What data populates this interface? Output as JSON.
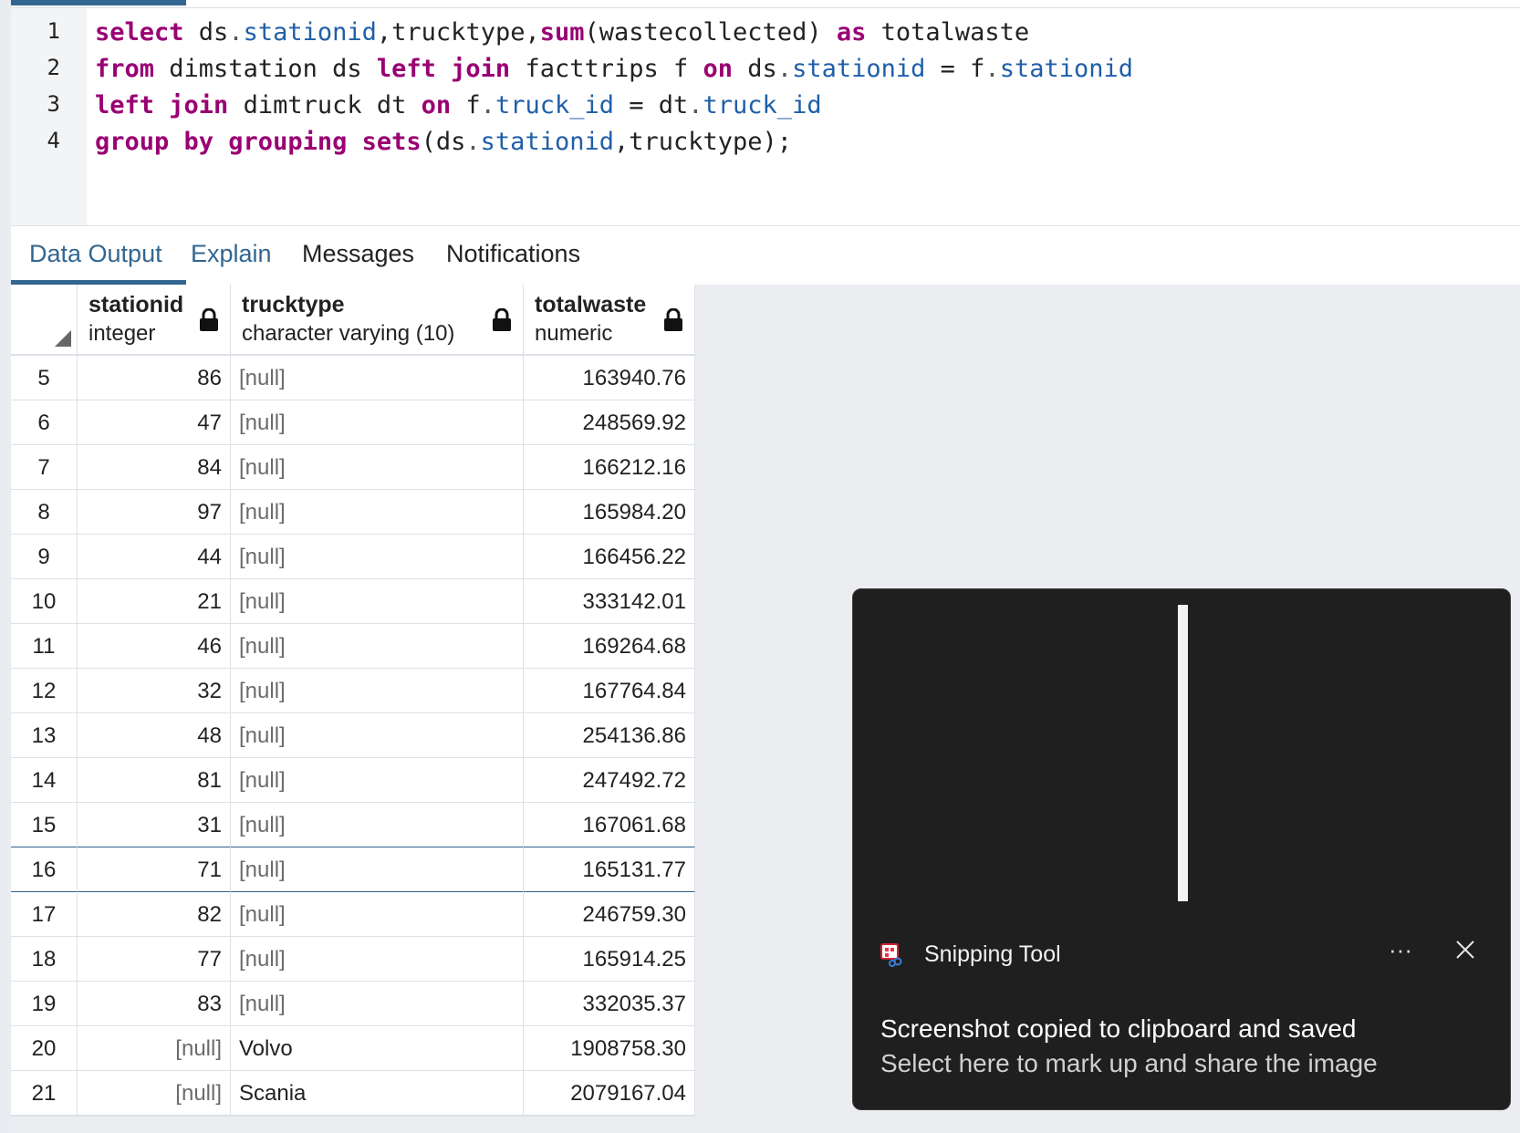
{
  "editor": {
    "line_numbers": [
      "1",
      "2",
      "3",
      "4"
    ],
    "lines": [
      [
        {
          "t": "select",
          "c": "kw"
        },
        {
          "t": " ds",
          "c": ""
        },
        {
          "t": ".",
          "c": "punc"
        },
        {
          "t": "stationid",
          "c": "col"
        },
        {
          "t": ",trucktype,",
          "c": ""
        },
        {
          "t": "sum",
          "c": "fn"
        },
        {
          "t": "(wastecollected)",
          "c": ""
        },
        {
          "t": " as",
          "c": "kw"
        },
        {
          "t": " totalwaste",
          "c": ""
        }
      ],
      [
        {
          "t": "from",
          "c": "kw"
        },
        {
          "t": " dimstation ds ",
          "c": ""
        },
        {
          "t": "left join",
          "c": "kw"
        },
        {
          "t": " facttrips f ",
          "c": ""
        },
        {
          "t": "on",
          "c": "kw"
        },
        {
          "t": " ds",
          "c": ""
        },
        {
          "t": ".",
          "c": "punc"
        },
        {
          "t": "stationid",
          "c": "col"
        },
        {
          "t": " = f",
          "c": ""
        },
        {
          "t": ".",
          "c": "punc"
        },
        {
          "t": "stationid",
          "c": "col"
        }
      ],
      [
        {
          "t": "left join",
          "c": "kw"
        },
        {
          "t": " dimtruck dt ",
          "c": ""
        },
        {
          "t": "on",
          "c": "kw"
        },
        {
          "t": " f",
          "c": ""
        },
        {
          "t": ".",
          "c": "punc"
        },
        {
          "t": "truck_id",
          "c": "col"
        },
        {
          "t": " = dt",
          "c": ""
        },
        {
          "t": ".",
          "c": "punc"
        },
        {
          "t": "truck_id",
          "c": "col"
        }
      ],
      [
        {
          "t": "group by grouping sets",
          "c": "kw"
        },
        {
          "t": "(ds",
          "c": ""
        },
        {
          "t": ".",
          "c": "punc"
        },
        {
          "t": "stationid",
          "c": "col"
        },
        {
          "t": ",trucktype);",
          "c": ""
        }
      ]
    ]
  },
  "tabs": [
    {
      "label": "Data Output",
      "active": true
    },
    {
      "label": "Explain",
      "active": false
    },
    {
      "label": "Messages",
      "active": false
    },
    {
      "label": "Notifications",
      "active": false
    }
  ],
  "grid": {
    "columns": [
      {
        "name": "stationid",
        "type": "integer"
      },
      {
        "name": "trucktype",
        "type": "character varying (10)"
      },
      {
        "name": "totalwaste",
        "type": "numeric"
      }
    ],
    "rows": [
      {
        "n": "5",
        "stationid": "86",
        "trucktype": "[null]",
        "totalwaste": "163940.76"
      },
      {
        "n": "6",
        "stationid": "47",
        "trucktype": "[null]",
        "totalwaste": "248569.92"
      },
      {
        "n": "7",
        "stationid": "84",
        "trucktype": "[null]",
        "totalwaste": "166212.16"
      },
      {
        "n": "8",
        "stationid": "97",
        "trucktype": "[null]",
        "totalwaste": "165984.20"
      },
      {
        "n": "9",
        "stationid": "44",
        "trucktype": "[null]",
        "totalwaste": "166456.22"
      },
      {
        "n": "10",
        "stationid": "21",
        "trucktype": "[null]",
        "totalwaste": "333142.01"
      },
      {
        "n": "11",
        "stationid": "46",
        "trucktype": "[null]",
        "totalwaste": "169264.68"
      },
      {
        "n": "12",
        "stationid": "32",
        "trucktype": "[null]",
        "totalwaste": "167764.84"
      },
      {
        "n": "13",
        "stationid": "48",
        "trucktype": "[null]",
        "totalwaste": "254136.86"
      },
      {
        "n": "14",
        "stationid": "81",
        "trucktype": "[null]",
        "totalwaste": "247492.72"
      },
      {
        "n": "15",
        "stationid": "31",
        "trucktype": "[null]",
        "totalwaste": "167061.68"
      },
      {
        "n": "16",
        "stationid": "71",
        "trucktype": "[null]",
        "totalwaste": "165131.77",
        "selected": true
      },
      {
        "n": "17",
        "stationid": "82",
        "trucktype": "[null]",
        "totalwaste": "246759.30"
      },
      {
        "n": "18",
        "stationid": "77",
        "trucktype": "[null]",
        "totalwaste": "165914.25"
      },
      {
        "n": "19",
        "stationid": "83",
        "trucktype": "[null]",
        "totalwaste": "332035.37"
      },
      {
        "n": "20",
        "stationid": "[null]",
        "trucktype": "Volvo",
        "totalwaste": "1908758.30"
      },
      {
        "n": "21",
        "stationid": "[null]",
        "trucktype": "Scania",
        "totalwaste": "2079167.04"
      }
    ]
  },
  "toast": {
    "app_name": "Snipping Tool",
    "more": "···",
    "title": "Screenshot copied to clipboard and saved",
    "body": "Select here to mark up and share the image"
  }
}
